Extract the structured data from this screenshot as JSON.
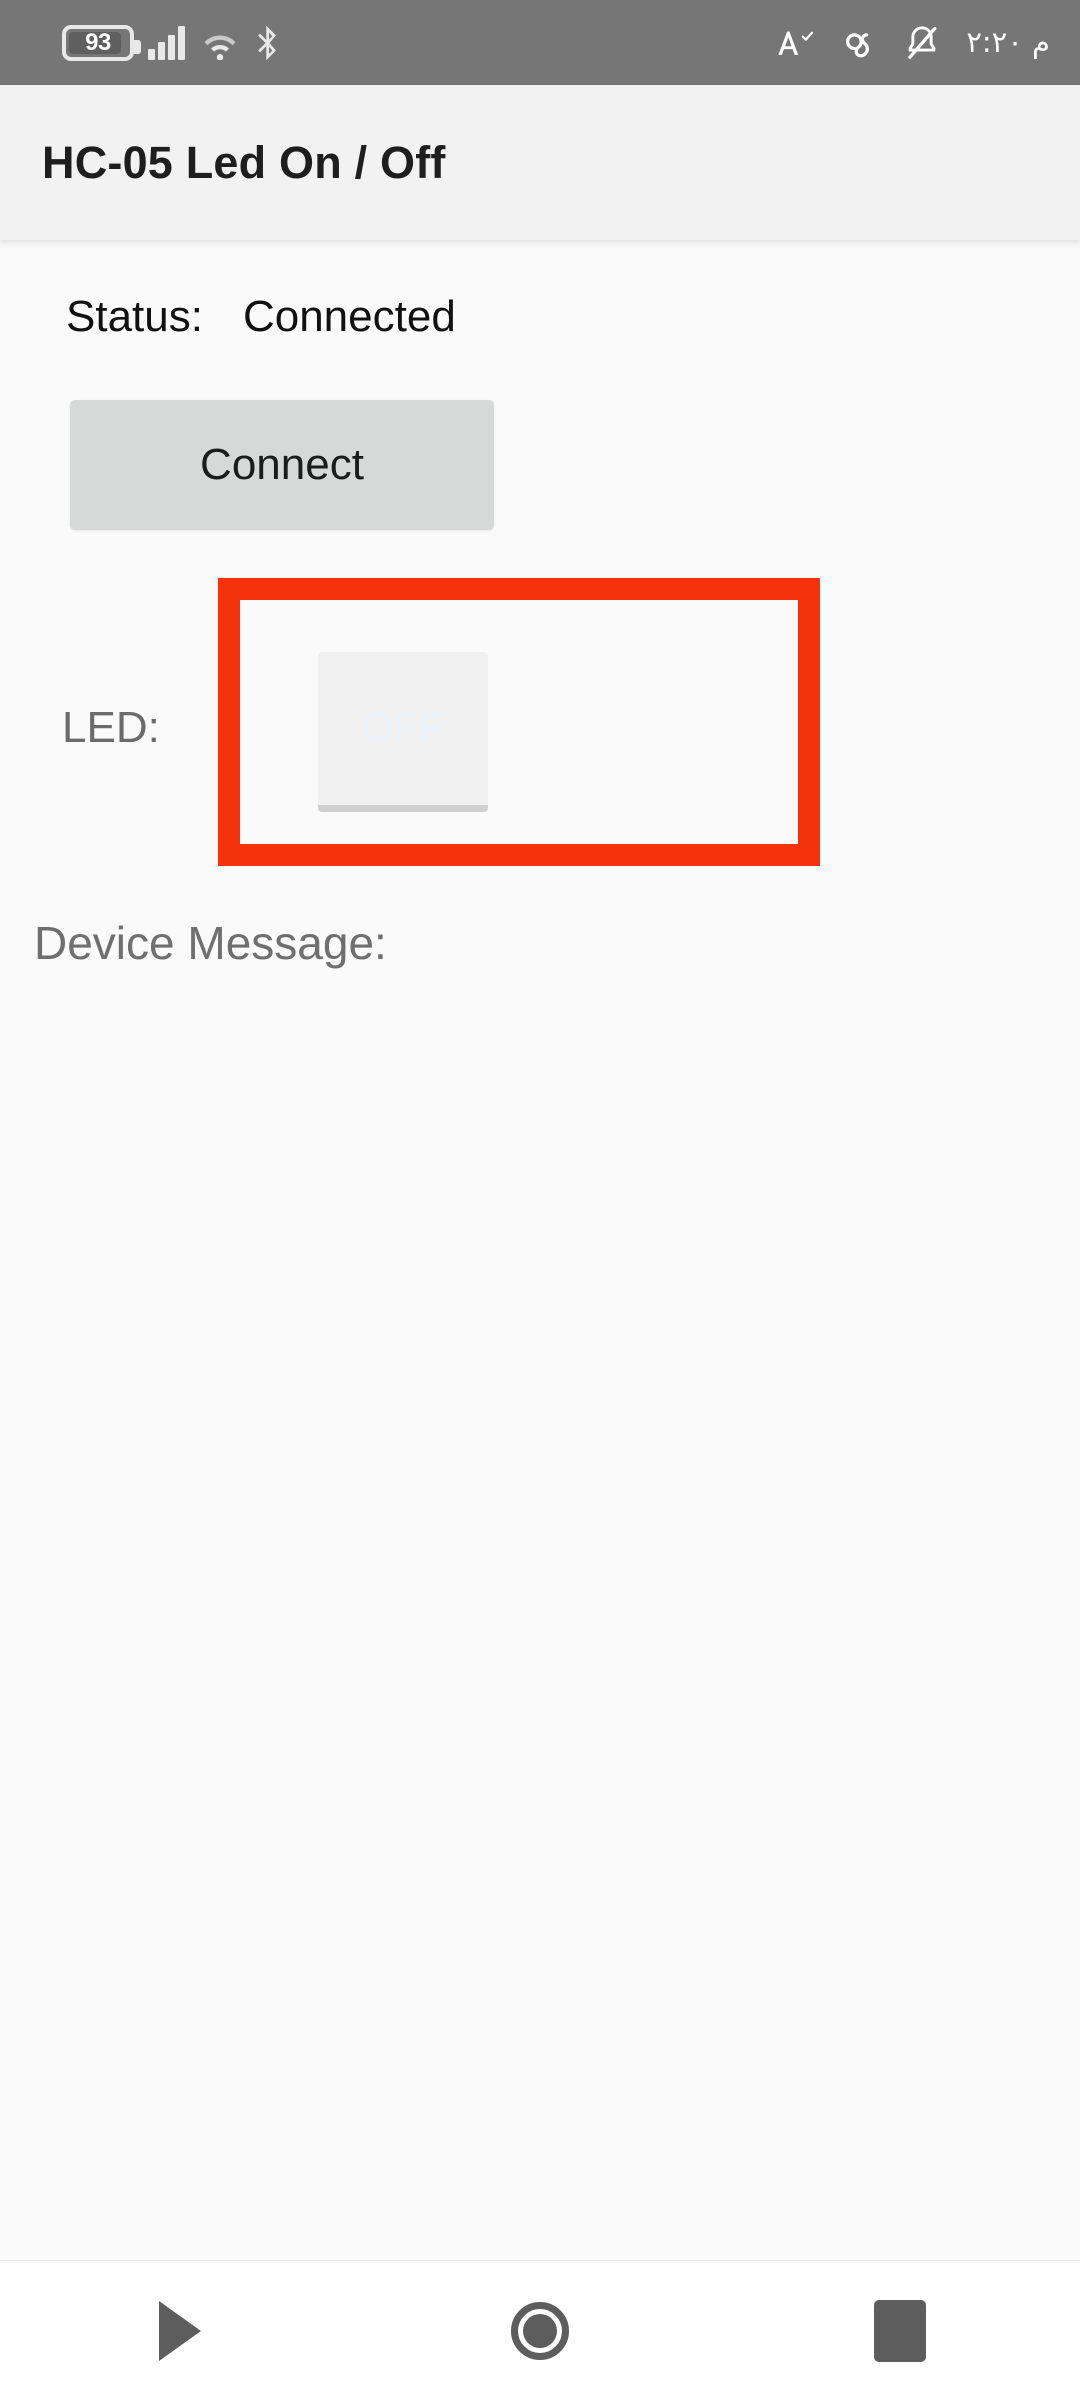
{
  "status_bar": {
    "battery_level": "93",
    "icons_left": [
      "battery-icon",
      "signal-icon",
      "wifi-icon",
      "bluetooth-icon"
    ],
    "icons_right": [
      "text-size-icon",
      "link-icon",
      "bell-muted-icon"
    ],
    "time": "م ٢:٢٠"
  },
  "app_bar": {
    "title": "HC-05 Led On / Off"
  },
  "content": {
    "status_label": "Status:",
    "status_value": "Connected",
    "connect_button_label": "Connect",
    "led_label": "LED:",
    "led_toggle_label": "OFF",
    "device_message_label": "Device Message:",
    "device_message_value": ""
  },
  "highlight": {
    "color": "#f4330d"
  },
  "nav_bar": {
    "back_label": "back-triangle-icon",
    "home_label": "home-circle-icon",
    "recents_label": "recents-square-icon"
  }
}
